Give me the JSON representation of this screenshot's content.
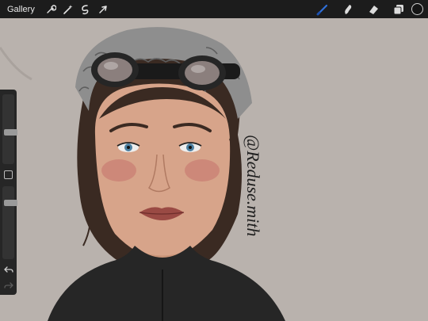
{
  "topbar": {
    "gallery_label": "Gallery",
    "left_tools": [
      "wrench-icon",
      "magic-wand-icon",
      "selection-icon",
      "transform-arrow-icon"
    ],
    "right_tools": [
      "brush-icon",
      "smudge-icon",
      "eraser-icon",
      "layers-icon"
    ],
    "accent_color": "#2f6fd9",
    "current_color": "#151515"
  },
  "canvas": {
    "background": "#b9b2ad",
    "signature": "@Reduse.mith"
  },
  "sidebar": {
    "brush_size_level": 0.45,
    "opacity_level": 0.8,
    "undo_icon": "undo-icon",
    "redo_icon": "redo-icon"
  }
}
